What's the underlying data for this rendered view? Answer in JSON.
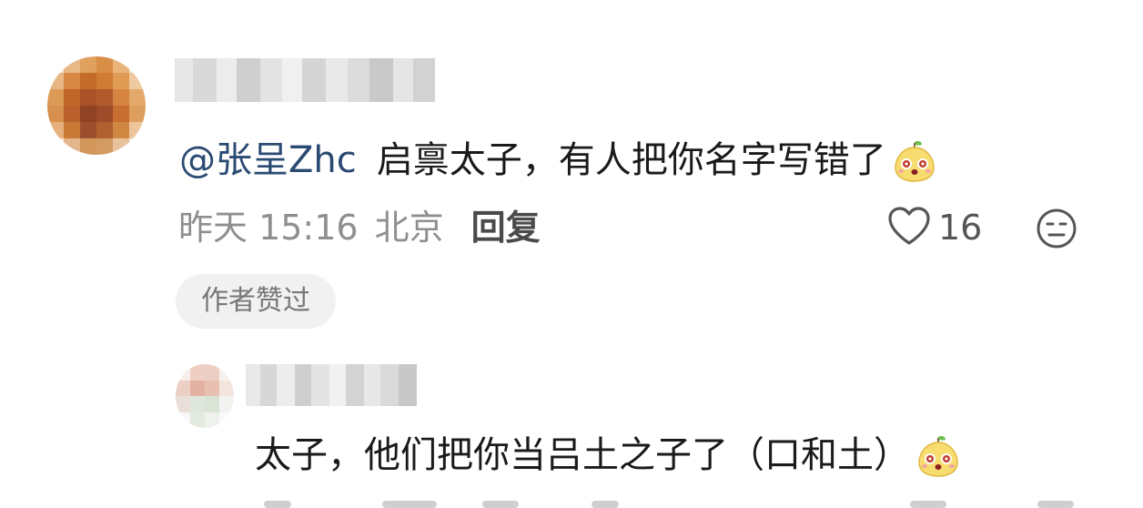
{
  "comment": {
    "mention": "@张呈Zhc",
    "text": "启禀太子，有人把你名字写错了",
    "emoji": "pear-emoji",
    "time": "昨天 15:16",
    "location": "北京",
    "reply_label": "回复",
    "like_count": "16",
    "author_badge": "作者赞过"
  },
  "reply": {
    "text": "太子，他们把你当吕土之子了（口和土）",
    "emoji": "pear-emoji"
  },
  "colors": {
    "mention": "#2b4a72",
    "meta": "#8f8f8f",
    "badge_bg": "#f1f1f1"
  }
}
